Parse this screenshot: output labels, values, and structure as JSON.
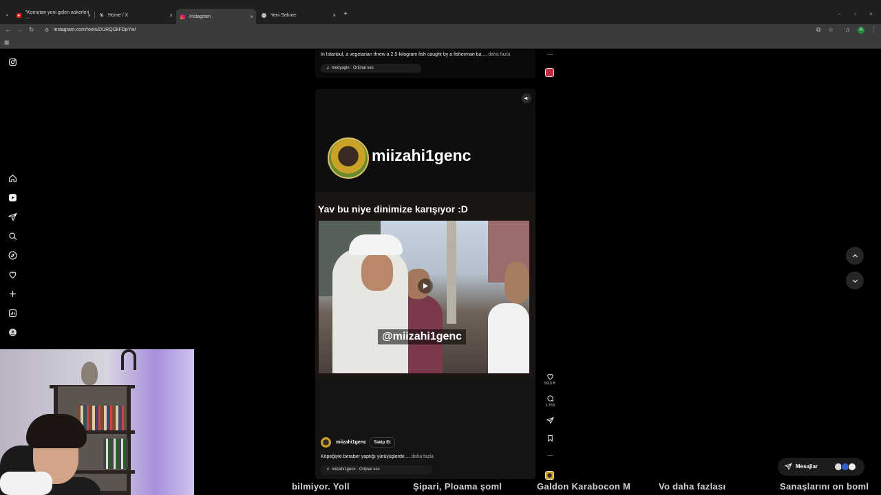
{
  "browser": {
    "tabs": [
      {
        "title": "\"Komutan yeni gelen askerleri ..."
      },
      {
        "title": "Home / X"
      },
      {
        "title": "Instagram"
      },
      {
        "title": "Yeni Sekme"
      }
    ],
    "address": "instagram.com/reels/DURQOkFDpYw/",
    "profile_initial": "R"
  },
  "previous_reel": {
    "caption": "In Istanbul, a vegetarian threw a 2.5-kilogram fish caught by a fisherman ba ...",
    "more": "daha fazla",
    "audio": "medyaglo · Orijinal ses"
  },
  "reel": {
    "channel_overlay": "miizahi1genc",
    "headline": "Yav bu niye dinimize karışıyor :D",
    "watermark": "@miizahi1genc",
    "username": "miizahi1genc",
    "follow_label": "Takip Et",
    "caption": "Köpeğiyle beraber yaptığı yürüyüşlerde ...",
    "more": "daha fazla",
    "audio": "miizahi1genc · Orijinal ses",
    "likes": "59,3 B",
    "comments": "1.763"
  },
  "messages": {
    "label": "Mesajlar"
  },
  "subtitles": [
    "bilmiyor. Yoll",
    "Şipari, Ploama şoml",
    "Galdon Karabocon M",
    "Vo daha fazlası",
    "Sanaşlarını on boml"
  ],
  "colors": {
    "accent_red": "#c02a38",
    "background": "#000000",
    "chrome": "#3b3b3b"
  }
}
